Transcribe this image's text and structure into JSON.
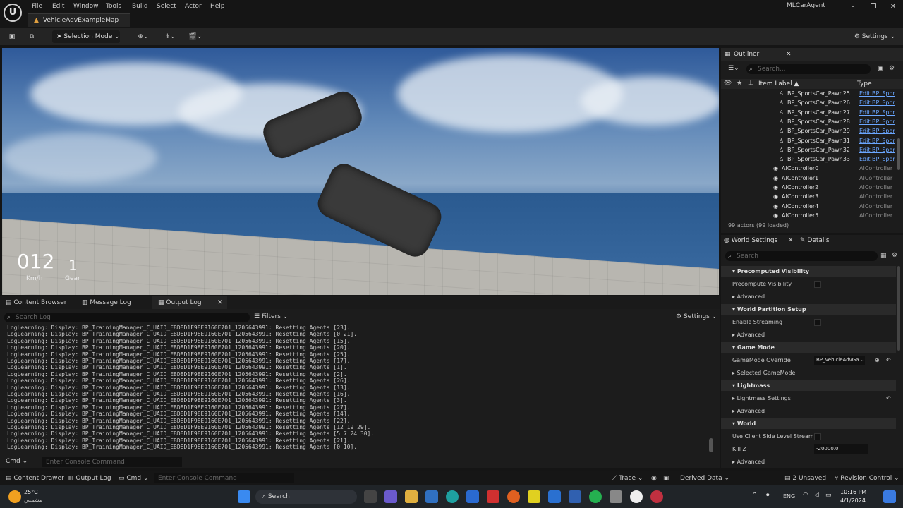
{
  "menu": [
    "File",
    "Edit",
    "Window",
    "Tools",
    "Build",
    "Select",
    "Actor",
    "Help"
  ],
  "map_tab": "VehicleAdvExampleMap",
  "project_name": "MLCarAgent",
  "toolbar": {
    "selection_mode": "Selection Mode",
    "settings": "Settings"
  },
  "hud": {
    "speed": "012",
    "speed_unit": "Km/h",
    "gear": "1",
    "gear_label": "Gear"
  },
  "bottom_tabs": {
    "content_browser": "Content Browser",
    "message_log": "Message Log",
    "output_log": "Output Log"
  },
  "log": {
    "search_placeholder": "Search Log",
    "filters": "Filters",
    "settings": "Settings",
    "lines": [
      "LogLearning: Display: BP_TrainingManager_C_UAID_E8D8D1F98E9160E701_1205643991: Resetting Agents [23].",
      "LogLearning: Display: BP_TrainingManager_C_UAID_E8D8D1F98E9160E701_1205643991: Resetting Agents [0 21].",
      "LogLearning: Display: BP_TrainingManager_C_UAID_E8D8D1F98E9160E701_1205643991: Resetting Agents [15].",
      "LogLearning: Display: BP_TrainingManager_C_UAID_E8D8D1F98E9160E701_1205643991: Resetting Agents [20].",
      "LogLearning: Display: BP_TrainingManager_C_UAID_E8D8D1F98E9160E701_1205643991: Resetting Agents [25].",
      "LogLearning: Display: BP_TrainingManager_C_UAID_E8D8D1F98E9160E701_1205643991: Resetting Agents [17].",
      "LogLearning: Display: BP_TrainingManager_C_UAID_E8D8D1F98E9160E701_1205643991: Resetting Agents [1].",
      "LogLearning: Display: BP_TrainingManager_C_UAID_E8D8D1F98E9160E701_1205643991: Resetting Agents [2].",
      "LogLearning: Display: BP_TrainingManager_C_UAID_E8D8D1F98E9160E701_1205643991: Resetting Agents [26].",
      "LogLearning: Display: BP_TrainingManager_C_UAID_E8D8D1F98E9160E701_1205643991: Resetting Agents [13].",
      "LogLearning: Display: BP_TrainingManager_C_UAID_E8D8D1F98E9160E701_1205643991: Resetting Agents [16].",
      "LogLearning: Display: BP_TrainingManager_C_UAID_E8D8D1F98E9160E701_1205643991: Resetting Agents [3].",
      "LogLearning: Display: BP_TrainingManager_C_UAID_E8D8D1F98E9160E701_1205643991: Resetting Agents [27].",
      "LogLearning: Display: BP_TrainingManager_C_UAID_E8D8D1F98E9160E701_1205643991: Resetting Agents [14].",
      "LogLearning: Display: BP_TrainingManager_C_UAID_E8D8D1F98E9160E701_1205643991: Resetting Agents [22].",
      "LogLearning: Display: BP_TrainingManager_C_UAID_E8D8D1F98E9160E701_1205643991: Resetting Agents [12 19 29].",
      "LogLearning: Display: BP_TrainingManager_C_UAID_E8D8D1F98E9160E701_1205643991: Resetting Agents [5 7 24 30].",
      "LogLearning: Display: BP_TrainingManager_C_UAID_E8D8D1F98E9160E701_1205643991: Resetting Agents [21].",
      "LogLearning: Display: BP_TrainingManager_C_UAID_E8D8D1F98E9160E701_1205643991: Resetting Agents [0 10]."
    ],
    "cmd_label": "Cmd",
    "cmd_placeholder": "Enter Console Command"
  },
  "statusbar": {
    "content_drawer": "Content Drawer",
    "output_log": "Output Log",
    "cmd": "Cmd",
    "cmd_placeholder": "Enter Console Command",
    "trace": "Trace",
    "derived_data": "Derived Data",
    "unsaved": "2 Unsaved",
    "revision_control": "Revision Control"
  },
  "outliner": {
    "title": "Outliner",
    "search_placeholder": "Search...",
    "col_label": "Item Label",
    "col_type": "Type",
    "pawns": [
      {
        "label": "BP_SportsCar_Pawn25",
        "type": "Edit BP_Spor"
      },
      {
        "label": "BP_SportsCar_Pawn26",
        "type": "Edit BP_Spor"
      },
      {
        "label": "BP_SportsCar_Pawn27",
        "type": "Edit BP_Spor"
      },
      {
        "label": "BP_SportsCar_Pawn28",
        "type": "Edit BP_Spor"
      },
      {
        "label": "BP_SportsCar_Pawn29",
        "type": "Edit BP_Spor"
      },
      {
        "label": "BP_SportsCar_Pawn31",
        "type": "Edit BP_Spor"
      },
      {
        "label": "BP_SportsCar_Pawn32",
        "type": "Edit BP_Spor"
      },
      {
        "label": "BP_SportsCar_Pawn33",
        "type": "Edit BP_Spor"
      }
    ],
    "controllers": [
      {
        "label": "AIController0",
        "type": "AIController"
      },
      {
        "label": "AIController1",
        "type": "AIController"
      },
      {
        "label": "AIController2",
        "type": "AIController"
      },
      {
        "label": "AIController3",
        "type": "AIController"
      },
      {
        "label": "AIController4",
        "type": "AIController"
      },
      {
        "label": "AIController5",
        "type": "AIController"
      }
    ],
    "actor_count": "99 actors (99 loaded)"
  },
  "details": {
    "tab_world": "World Settings",
    "tab_details": "Details",
    "search_placeholder": "Search",
    "rows": {
      "precomputed_visibility": "Precomputed Visibility",
      "precompute_visibility": "Precompute Visibility",
      "advanced": "Advanced",
      "world_partition_setup": "World Partition Setup",
      "enable_streaming": "Enable Streaming",
      "game_mode": "Game Mode",
      "gamemode_override": "GameMode Override",
      "gamemode_value": "BP_VehicleAdvGa",
      "selected_gamemode": "Selected GameMode",
      "lightmass": "Lightmass",
      "lightmass_settings": "Lightmass Settings",
      "world": "World",
      "client_side_streaming": "Use Client Side Level Streami...",
      "kill_z": "Kill Z",
      "kill_z_value": "-20000.0"
    }
  },
  "taskbar": {
    "weather_temp": "25°C",
    "weather_sub": "مشمس",
    "search": "Search",
    "lang": "ENG",
    "time": "10:16 PM",
    "date": "4/1/2024"
  }
}
